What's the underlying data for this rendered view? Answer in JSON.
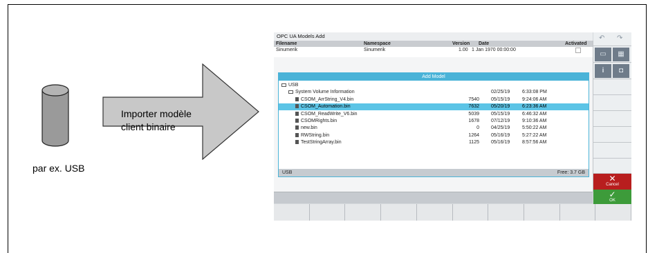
{
  "figure": {
    "arrow_label_line1": "Importer modèle",
    "arrow_label_line2": "client binaire",
    "device_caption": "par ex. USB"
  },
  "screen": {
    "title": "OPC UA Models Add",
    "columns": {
      "filename": "Filename",
      "namespace": "Namespace",
      "version": "Version",
      "date": "Date",
      "activated": "Activated"
    },
    "first_row": {
      "filename": "Sinumerik",
      "namespace": "Sinumerik",
      "version": "1.00",
      "date": "1 Jan 1970 00:00:00"
    },
    "dialog": {
      "title": "Add Model",
      "root": "USB",
      "folder": "System Volume Information",
      "folder_date": "02/25/19",
      "folder_time": "6:33:08 PM",
      "files": [
        {
          "name": "CSOM_ArrString_V4.bin",
          "size": "7540",
          "date": "05/15/19",
          "time": "9:24:06 AM",
          "selected": false
        },
        {
          "name": "CSOM_Automation.bin",
          "size": "7632",
          "date": "05/20/19",
          "time": "6:23:36 AM",
          "selected": true
        },
        {
          "name": "CSOM_ReadWrite_V6.bin",
          "size": "5039",
          "date": "05/15/19",
          "time": "6:46:32 AM",
          "selected": false
        },
        {
          "name": "CSOMRights.bin",
          "size": "1678",
          "date": "07/12/19",
          "time": "9:10:36 AM",
          "selected": false
        },
        {
          "name": "new.bin",
          "size": "0",
          "date": "04/25/19",
          "time": "5:50:22 AM",
          "selected": false
        },
        {
          "name": "RWString.bin",
          "size": "1264",
          "date": "05/16/19",
          "time": "5:27:22 AM",
          "selected": false
        },
        {
          "name": "TestStringArray.bin",
          "size": "1125",
          "date": "05/16/19",
          "time": "8:57:56 AM",
          "selected": false
        }
      ],
      "status_left": "USB",
      "status_right": "Free: 3.7 GB"
    },
    "side": {
      "info_glyph": "i",
      "cancel_label": "Cancel",
      "ok_label": "OK"
    }
  }
}
